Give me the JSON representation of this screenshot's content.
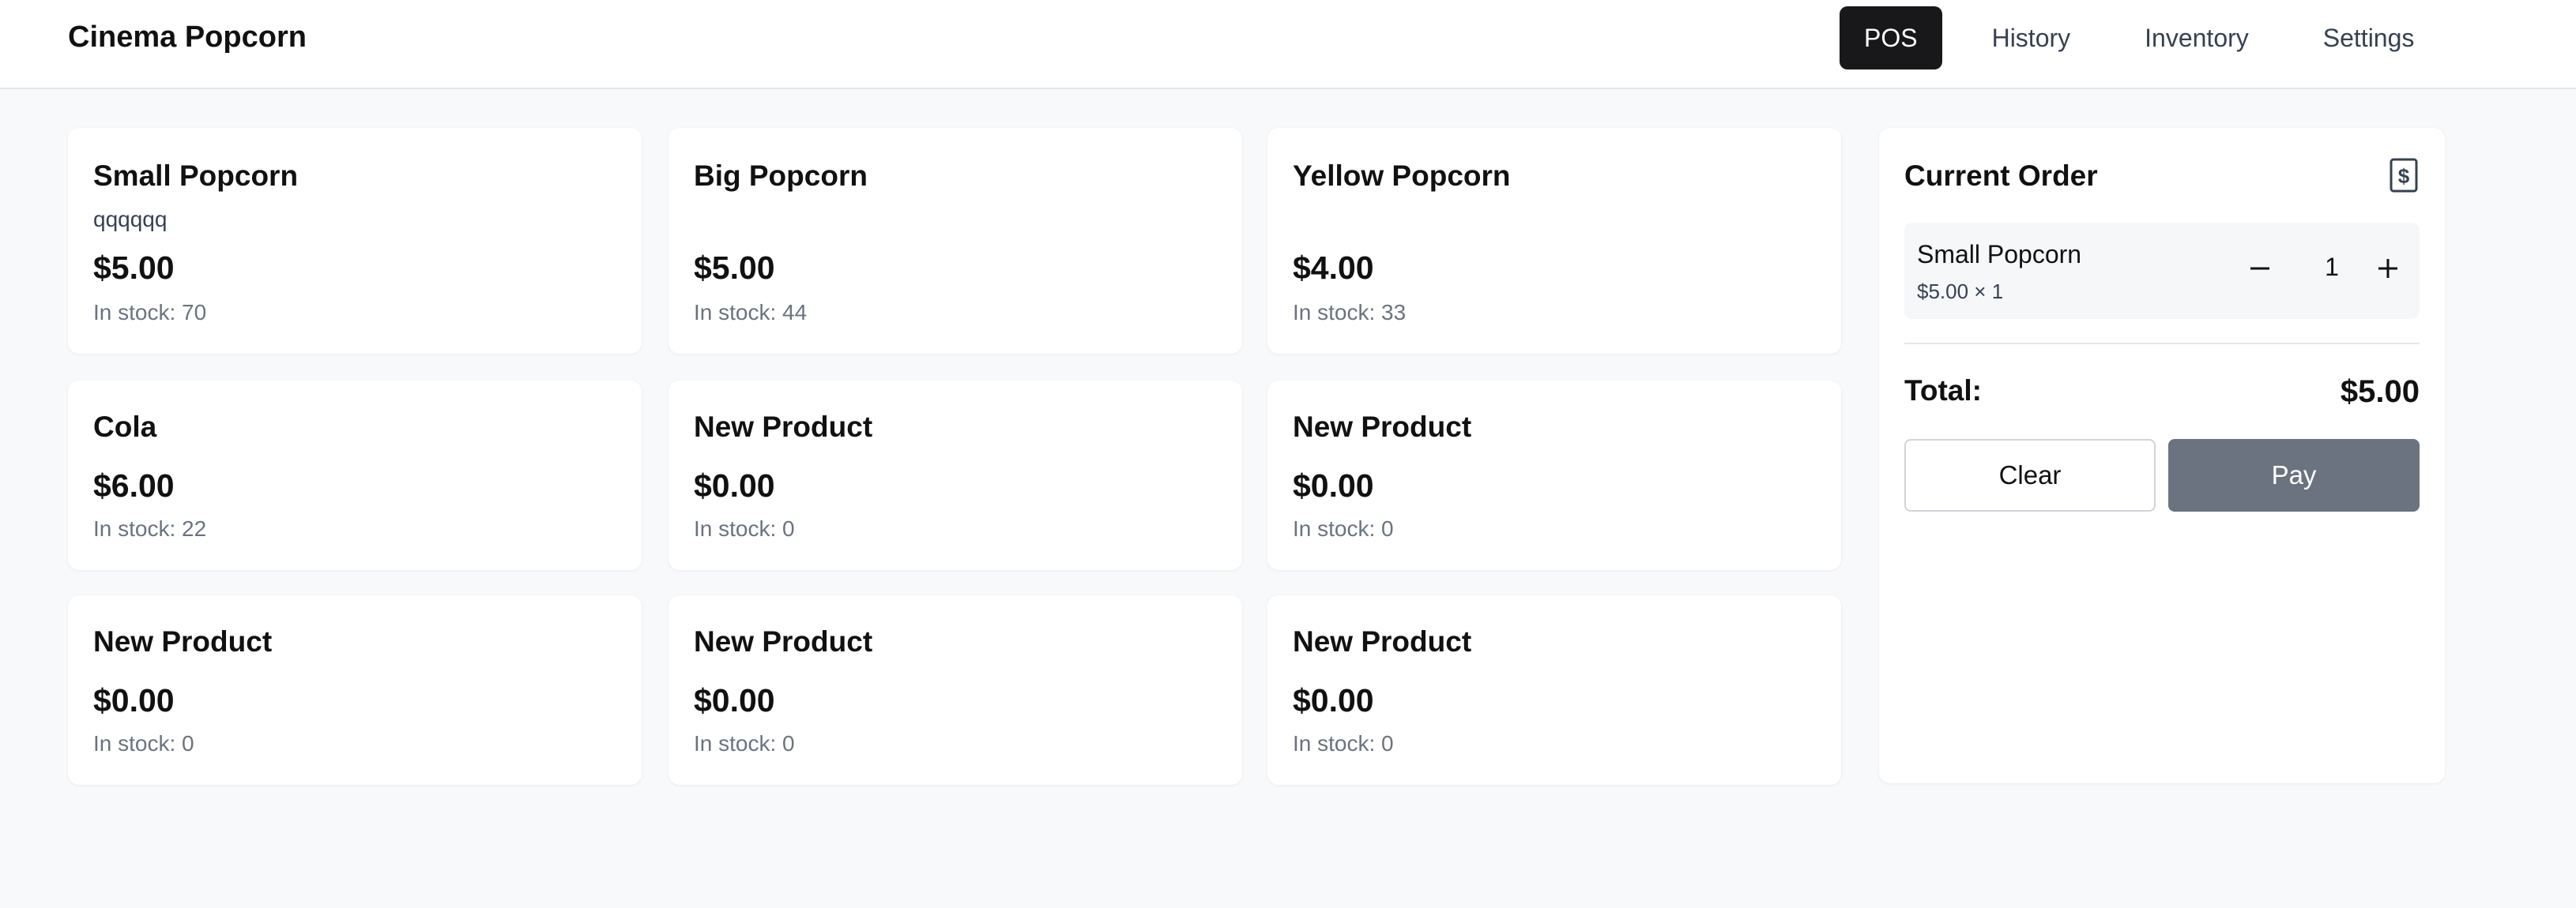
{
  "app": {
    "title": "Cinema Popcorn"
  },
  "nav": {
    "tabs": [
      {
        "label": "POS",
        "active": true
      },
      {
        "label": "History"
      },
      {
        "label": "Inventory"
      },
      {
        "label": "Settings"
      }
    ]
  },
  "products": [
    {
      "name": "Small Popcorn",
      "description": "qqqqqq",
      "price": "$5.00",
      "stock": "In stock: 70"
    },
    {
      "name": "Big Popcorn",
      "description": "",
      "price": "$5.00",
      "stock": "In stock: 44"
    },
    {
      "name": "Yellow Popcorn",
      "description": "",
      "price": "$4.00",
      "stock": "In stock: 33"
    },
    {
      "name": "Cola",
      "description": "",
      "price": "$6.00",
      "stock": "In stock: 22"
    },
    {
      "name": "New Product",
      "description": "",
      "price": "$0.00",
      "stock": "In stock: 0"
    },
    {
      "name": "New Product",
      "description": "",
      "price": "$0.00",
      "stock": "In stock: 0"
    },
    {
      "name": "New Product",
      "description": "",
      "price": "$0.00",
      "stock": "In stock: 0"
    },
    {
      "name": "New Product",
      "description": "",
      "price": "$0.00",
      "stock": "In stock: 0"
    },
    {
      "name": "New Product",
      "description": "",
      "price": "$0.00",
      "stock": "In stock: 0"
    }
  ],
  "order": {
    "title": "Current Order",
    "icon": "receipt-icon",
    "items": [
      {
        "name": "Small Popcorn",
        "detail": "$5.00 × 1",
        "quantity": "1"
      }
    ],
    "total_label": "Total:",
    "total_value": "$5.00",
    "clear_label": "Clear",
    "pay_label": "Pay"
  },
  "colors": {
    "active_tab": "#18181b",
    "pay_button": "#6b7280",
    "background": "#f8f9fb"
  }
}
